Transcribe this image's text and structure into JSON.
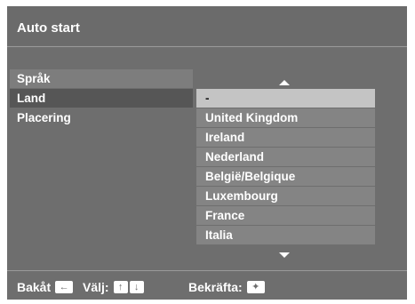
{
  "header": {
    "title": "Auto start"
  },
  "menu": {
    "items": [
      {
        "label": "Språk",
        "state": "normal"
      },
      {
        "label": "Land",
        "state": "active"
      },
      {
        "label": "Placering",
        "state": "plain"
      }
    ]
  },
  "country_list": {
    "items": [
      "-",
      "United Kingdom",
      "Ireland",
      "Nederland",
      "België/Belgique",
      "Luxembourg",
      "France",
      "Italia"
    ],
    "selected_index": 0
  },
  "footer": {
    "back_label": "Bakåt",
    "select_label": "Välj:",
    "confirm_label": "Bekräfta:",
    "back_key_icon": "←",
    "up_key_icon": "↑",
    "down_key_icon": "↓",
    "confirm_key_icon": "✦"
  },
  "colors": {
    "background": "#6e6e6e",
    "active_menu": "#565656",
    "menu_item": "#7d7d7d",
    "list_item": "#848484",
    "selected_item": "#c4c4c4"
  }
}
